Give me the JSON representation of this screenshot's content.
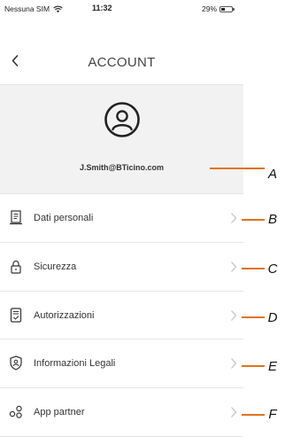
{
  "status_bar": {
    "carrier": "Nessuna SIM",
    "time": "11:32",
    "battery_text": "29%",
    "battery_level": 0.29,
    "wifi_icon": "wifi-icon"
  },
  "header": {
    "back_icon": "chevron-left-icon",
    "title": "ACCOUNT"
  },
  "profile": {
    "avatar_icon": "user-circle-icon",
    "email": "J.Smith@BTicino.com"
  },
  "menu": {
    "items": [
      {
        "label": "Dati personali",
        "icon": "document-icon"
      },
      {
        "label": "Sicurezza",
        "icon": "lock-icon"
      },
      {
        "label": "Autorizzazioni",
        "icon": "authorization-icon"
      },
      {
        "label": "Informazioni Legali",
        "icon": "legal-shield-icon"
      },
      {
        "label": "App partner",
        "icon": "partner-apps-icon"
      }
    ],
    "chevron_icon": "chevron-right-icon"
  },
  "callouts": {
    "color": "#e0731a",
    "labels": [
      "A",
      "B",
      "C",
      "D",
      "E",
      "F"
    ]
  }
}
